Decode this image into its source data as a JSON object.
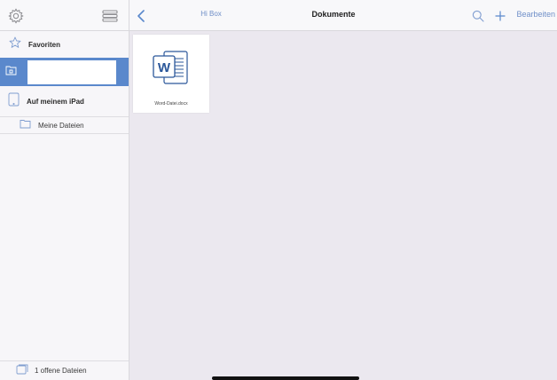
{
  "sidebar_header": {
    "settings_icon": "gear-icon",
    "list_icon": "list-icon"
  },
  "navbar": {
    "back_label": "Hi Box",
    "title": "Dokumente",
    "search_icon": "search-icon",
    "add_icon": "plus-icon",
    "edit_label": "Bearbeiten",
    "accent_color": "#6f8fc8"
  },
  "sidebar": {
    "favorites_label": "Favoriten",
    "box_input_value": "",
    "box_icon": "box-folder-icon",
    "selected_color": "#5a88cc",
    "ipad_label": "Auf meinem iPad",
    "my_files_label": "Meine Dateien",
    "footer_label": "1 offene Dateien"
  },
  "files": [
    {
      "name": "Word-Datei.docx",
      "icon": "word-document-icon",
      "brand_color": "#2b579a"
    }
  ]
}
